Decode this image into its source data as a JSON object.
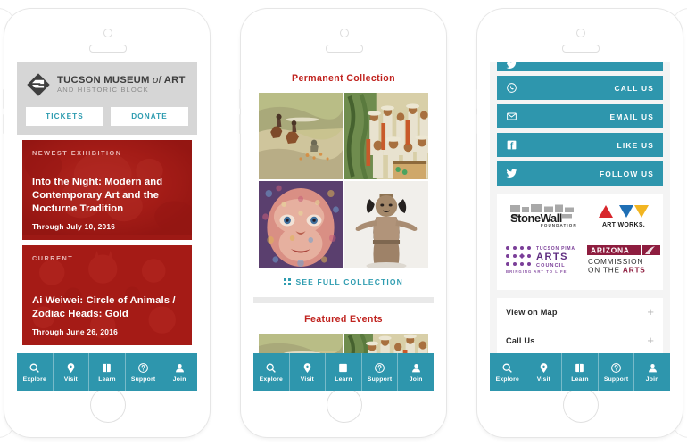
{
  "colors": {
    "teal": "#2e96ad",
    "teal_text": "#2e9cb0",
    "red_dark": "#9d1915",
    "red_heading": "#c0231f",
    "header_gray": "#d6d6d6"
  },
  "phone1": {
    "brand": {
      "line1_a": "TUCSON MUSEUM ",
      "line1_em": "of",
      "line1_b": " ART",
      "line2": "AND HISTORIC BLOCK",
      "logo_icon": "tma-diamond-logo"
    },
    "buttons": [
      {
        "label": "TICKETS",
        "name": "tickets-button"
      },
      {
        "label": "DONATE",
        "name": "donate-button"
      }
    ],
    "cards": [
      {
        "kicker": "NEWEST EXHIBITION",
        "title": "Into the Night: Modern and Contemporary Art and the Nocturne Tradition",
        "date": "Through July 10, 2016"
      },
      {
        "kicker": "CURRENT",
        "title": "Ai Weiwei: Circle of Animals / Zodiac Heads: Gold",
        "date": "Through June 26, 2016"
      }
    ]
  },
  "phone2": {
    "section1_title": "Permanent Collection",
    "tiles": [
      "painting-riders-on-horseback",
      "mural-crowd-of-figures",
      "mosaic-portrait-of-child",
      "ceramic-figure-sculpture"
    ],
    "see_all": "SEE FULL COLLECTION",
    "see_all_icon": "grid-dots-icon",
    "section2_title": "Featured Events",
    "event_tiles": [
      "painting-riders-on-horseback",
      "mural-crowd-of-figures"
    ]
  },
  "phone3": {
    "contact_buttons": [
      {
        "label": "CALL US",
        "icon": "phone-circle-icon",
        "name": "call-us-button"
      },
      {
        "label": "EMAIL US",
        "icon": "envelope-icon",
        "name": "email-us-button"
      },
      {
        "label": "LIKE US",
        "icon": "facebook-icon",
        "name": "like-us-button"
      },
      {
        "label": "FOLLOW US",
        "icon": "twitter-icon",
        "name": "follow-us-button"
      }
    ],
    "sponsors": [
      {
        "name": "stonewall-foundation-logo",
        "l1": "StoneWall",
        "l2": "FOUNDATION"
      },
      {
        "name": "art-works-nea-logo",
        "l1": "ART WORKS."
      },
      {
        "name": "tucson-pima-arts-council-logo",
        "l1": "TUCSON PIMA",
        "l2": "ARTS",
        "l3": "COUNCIL",
        "l4": "BRINGING ART TO LIFE"
      },
      {
        "name": "arizona-commission-on-the-arts-logo",
        "l1": "ARIZONA",
        "l2": "COMMISSION",
        "l3": "ON THE ",
        "l4": "ARTS"
      }
    ],
    "accordion": [
      {
        "label": "View on Map",
        "toggle": "+"
      },
      {
        "label": "Call Us",
        "toggle": "+"
      }
    ]
  },
  "nav": {
    "items": [
      {
        "label": "Explore",
        "icon": "search-icon"
      },
      {
        "label": "Visit",
        "icon": "map-pin-icon"
      },
      {
        "label": "Learn",
        "icon": "book-icon"
      },
      {
        "label": "Support",
        "icon": "question-circle-icon"
      },
      {
        "label": "Join",
        "icon": "person-icon"
      }
    ]
  }
}
